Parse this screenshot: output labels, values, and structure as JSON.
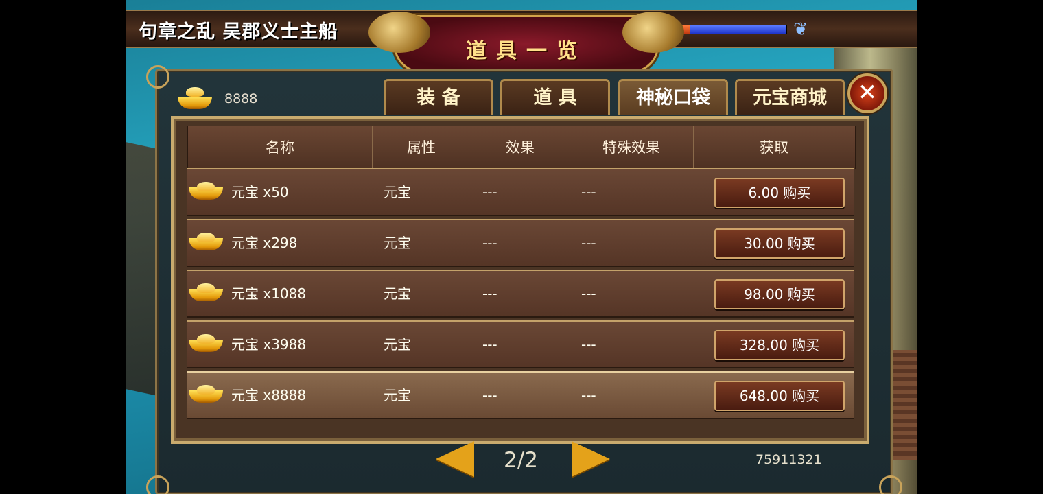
{
  "header": {
    "stage_title": "句章之乱 吴郡义士主船",
    "panel_title": "道具一览"
  },
  "currency": {
    "icon": "gold-ingot-icon",
    "amount": "8888"
  },
  "tabs": [
    {
      "label": "装 备",
      "active": false
    },
    {
      "label": "道 具",
      "active": false
    },
    {
      "label": "神秘口袋",
      "active": true
    },
    {
      "label": "元宝商城",
      "active": false
    }
  ],
  "table": {
    "columns": [
      "名称",
      "属性",
      "效果",
      "特殊效果",
      "获取"
    ],
    "rows": [
      {
        "name": "元宝 x50",
        "attribute": "元宝",
        "effect": "---",
        "special": "---",
        "buy": "6.00 购买"
      },
      {
        "name": "元宝 x298",
        "attribute": "元宝",
        "effect": "---",
        "special": "---",
        "buy": "30.00 购买"
      },
      {
        "name": "元宝 x1088",
        "attribute": "元宝",
        "effect": "---",
        "special": "---",
        "buy": "98.00 购买"
      },
      {
        "name": "元宝 x3988",
        "attribute": "元宝",
        "effect": "---",
        "special": "---",
        "buy": "328.00 购买"
      },
      {
        "name": "元宝 x8888",
        "attribute": "元宝",
        "effect": "---",
        "special": "---",
        "buy": "648.00 购买"
      }
    ]
  },
  "pagination": {
    "page": "2/2"
  },
  "footer": {
    "code": "75911321"
  },
  "hp_bar": {
    "red_fraction": 0.2,
    "blue_fraction": 0.8
  },
  "colors": {
    "gold": "#e4a21a",
    "accent_red": "#8a1a2a",
    "frame": "#c9ab6e"
  }
}
